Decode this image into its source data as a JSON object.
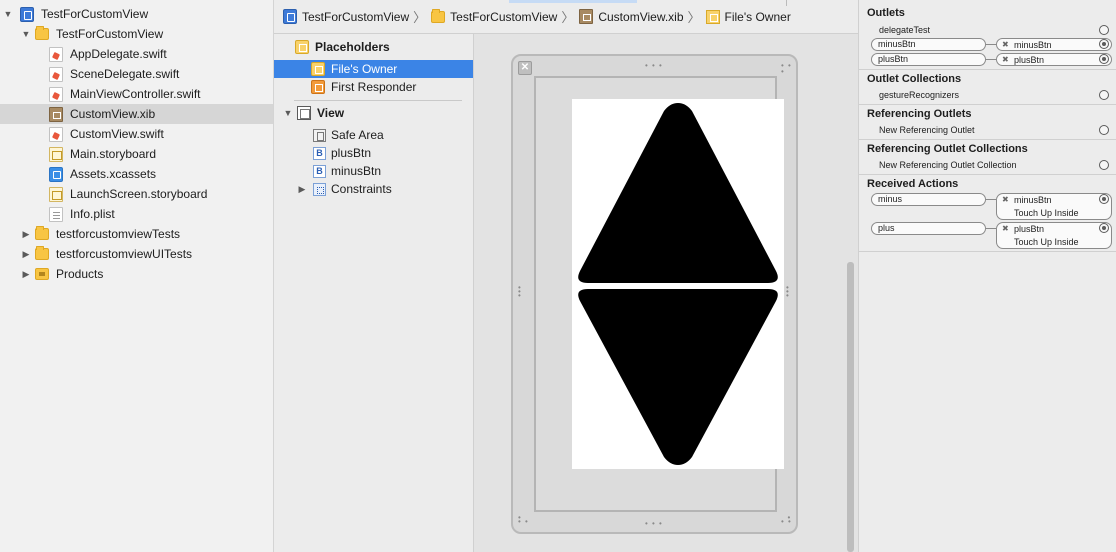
{
  "navigator": {
    "items": [
      {
        "label": "TestForCustomView",
        "disclosure": "▼",
        "icon": "project-icon"
      },
      {
        "label": "TestForCustomView",
        "disclosure": "▼",
        "icon": "folder-icon"
      },
      {
        "label": "AppDelegate.swift",
        "disclosure": "",
        "icon": "swift-file-icon"
      },
      {
        "label": "SceneDelegate.swift",
        "disclosure": "",
        "icon": "swift-file-icon"
      },
      {
        "label": "MainViewController.swift",
        "disclosure": "",
        "icon": "swift-file-icon"
      },
      {
        "label": "CustomView.xib",
        "disclosure": "",
        "icon": "xib-file-icon"
      },
      {
        "label": "CustomView.swift",
        "disclosure": "",
        "icon": "swift-file-icon"
      },
      {
        "label": "Main.storyboard",
        "disclosure": "",
        "icon": "storyboard-icon"
      },
      {
        "label": "Assets.xcassets",
        "disclosure": "",
        "icon": "assets-icon"
      },
      {
        "label": "LaunchScreen.storyboard",
        "disclosure": "",
        "icon": "storyboard-icon"
      },
      {
        "label": "Info.plist",
        "disclosure": "",
        "icon": "plist-icon"
      },
      {
        "label": "testforcustomviewTests",
        "disclosure": "▶",
        "icon": "folder-icon"
      },
      {
        "label": "testforcustomviewUITests",
        "disclosure": "▶",
        "icon": "folder-icon"
      },
      {
        "label": "Products",
        "disclosure": "▶",
        "icon": "products-folder-icon"
      }
    ],
    "selected_index": 5
  },
  "jumpbar": {
    "crumbs": [
      "TestForCustomView",
      "TestForCustomView",
      "CustomView.xib",
      "File's Owner"
    ]
  },
  "outline": {
    "placeholders_header": "Placeholders",
    "files_owner": "File's Owner",
    "first_responder": "First Responder",
    "view_header": "View",
    "safe_area": "Safe Area",
    "plus_btn": "plusBtn",
    "minus_btn": "minusBtn",
    "constraints": "Constraints",
    "button_badge": "B",
    "disclosure_open": "▼",
    "disclosure_closed": "▶"
  },
  "canvas": {
    "close_glyph": "✕",
    "handle_glyph": "• • •",
    "shape_color": "#000000",
    "view_background": "#ffffff"
  },
  "inspector": {
    "outlets": {
      "title": "Outlets",
      "delegate": "delegateTest",
      "minus_label": "minusBtn",
      "minus_target": "minusBtn",
      "plus_label": "plusBtn",
      "plus_target": "plusBtn"
    },
    "outlet_collections": {
      "title": "Outlet Collections",
      "gesture": "gestureRecognizers"
    },
    "referencing_outlets": {
      "title": "Referencing Outlets",
      "new": "New Referencing Outlet"
    },
    "referencing_outlet_collections": {
      "title": "Referencing Outlet Collections",
      "new": "New Referencing Outlet Collection"
    },
    "received_actions": {
      "title": "Received Actions",
      "minus_label": "minus",
      "minus_target": "minusBtn",
      "minus_event": "Touch Up Inside",
      "plus_label": "plus",
      "plus_target": "plusBtn",
      "plus_event": "Touch Up Inside"
    },
    "remove_glyph": "✖"
  }
}
